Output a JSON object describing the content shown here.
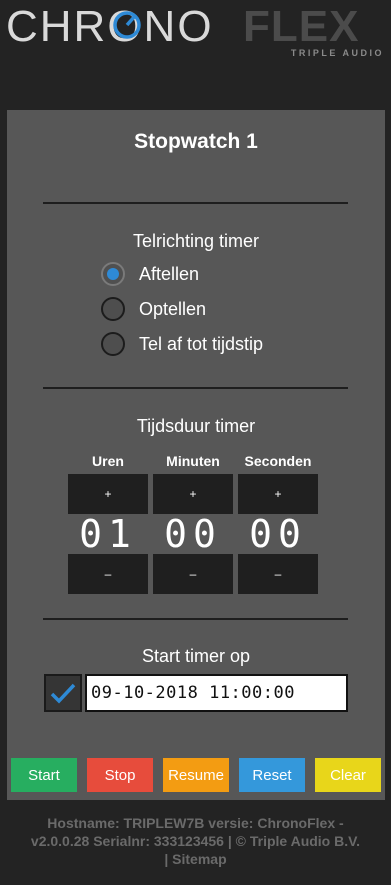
{
  "logo": {
    "part1": "CHRONO",
    "part2": "FLEX",
    "sub": "TRIPLE AUDIO",
    "accent": "#2e8ad6"
  },
  "panel": {
    "title": "Stopwatch 1"
  },
  "direction": {
    "label": "Telrichting timer",
    "options": [
      {
        "label": "Aftellen",
        "checked": true
      },
      {
        "label": "Optellen",
        "checked": false
      },
      {
        "label": "Tel af tot tijdstip",
        "checked": false
      }
    ]
  },
  "duration": {
    "label": "Tijdsduur timer",
    "units": [
      {
        "name": "Uren",
        "value": "01",
        "plus": "+",
        "minus": "–"
      },
      {
        "name": "Minuten",
        "value": "00",
        "plus": "+",
        "minus": "–"
      },
      {
        "name": "Seconden",
        "value": "00",
        "plus": "+",
        "minus": "–"
      }
    ]
  },
  "start_at": {
    "label": "Start timer op",
    "checked": true,
    "datetime": "09-10-2018 11:00:00"
  },
  "actions": [
    {
      "label": "Start",
      "color": "#27ae60"
    },
    {
      "label": "Stop",
      "color": "#e74c3c"
    },
    {
      "label": "Resume",
      "color": "#f39c12"
    },
    {
      "label": "Reset",
      "color": "#3498db"
    },
    {
      "label": "Clear",
      "color": "#e8d61a"
    }
  ],
  "footer": {
    "line1": "Hostname: TRIPLEW7B versie: ChronoFlex -",
    "line2": "v2.0.0.28 Serialnr: 333123456 | © Triple Audio B.V.",
    "line3": "| Sitemap"
  }
}
